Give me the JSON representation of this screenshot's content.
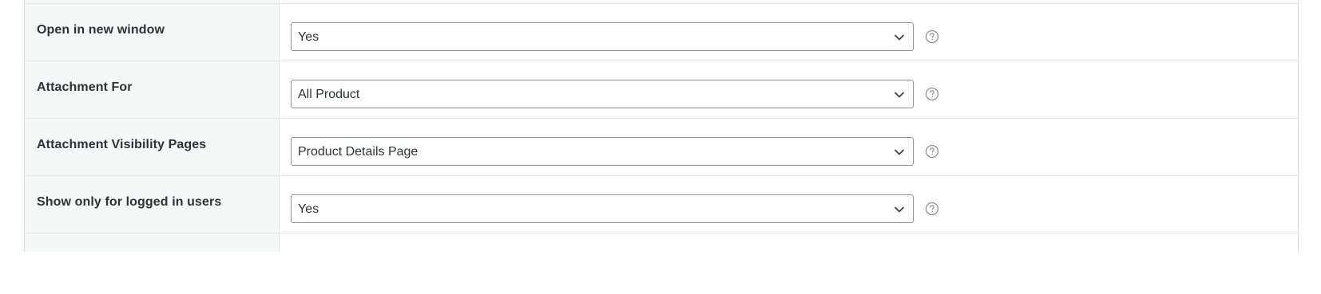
{
  "settings": {
    "rows": [
      {
        "label": "Open in new window",
        "value": "Yes"
      },
      {
        "label": "Attachment For",
        "value": "All Product"
      },
      {
        "label": "Attachment Visibility Pages",
        "value": "Product Details Page"
      },
      {
        "label": "Show only for logged in users",
        "value": "Yes"
      }
    ]
  },
  "icons": {
    "dropdown": "chevron-down-icon",
    "help": "help-circle-icon"
  },
  "colors": {
    "label_column_bg": "#f6f7f7",
    "border": "#8c8f94",
    "text": "#2c3338",
    "help_icon": "#8c8f94"
  }
}
